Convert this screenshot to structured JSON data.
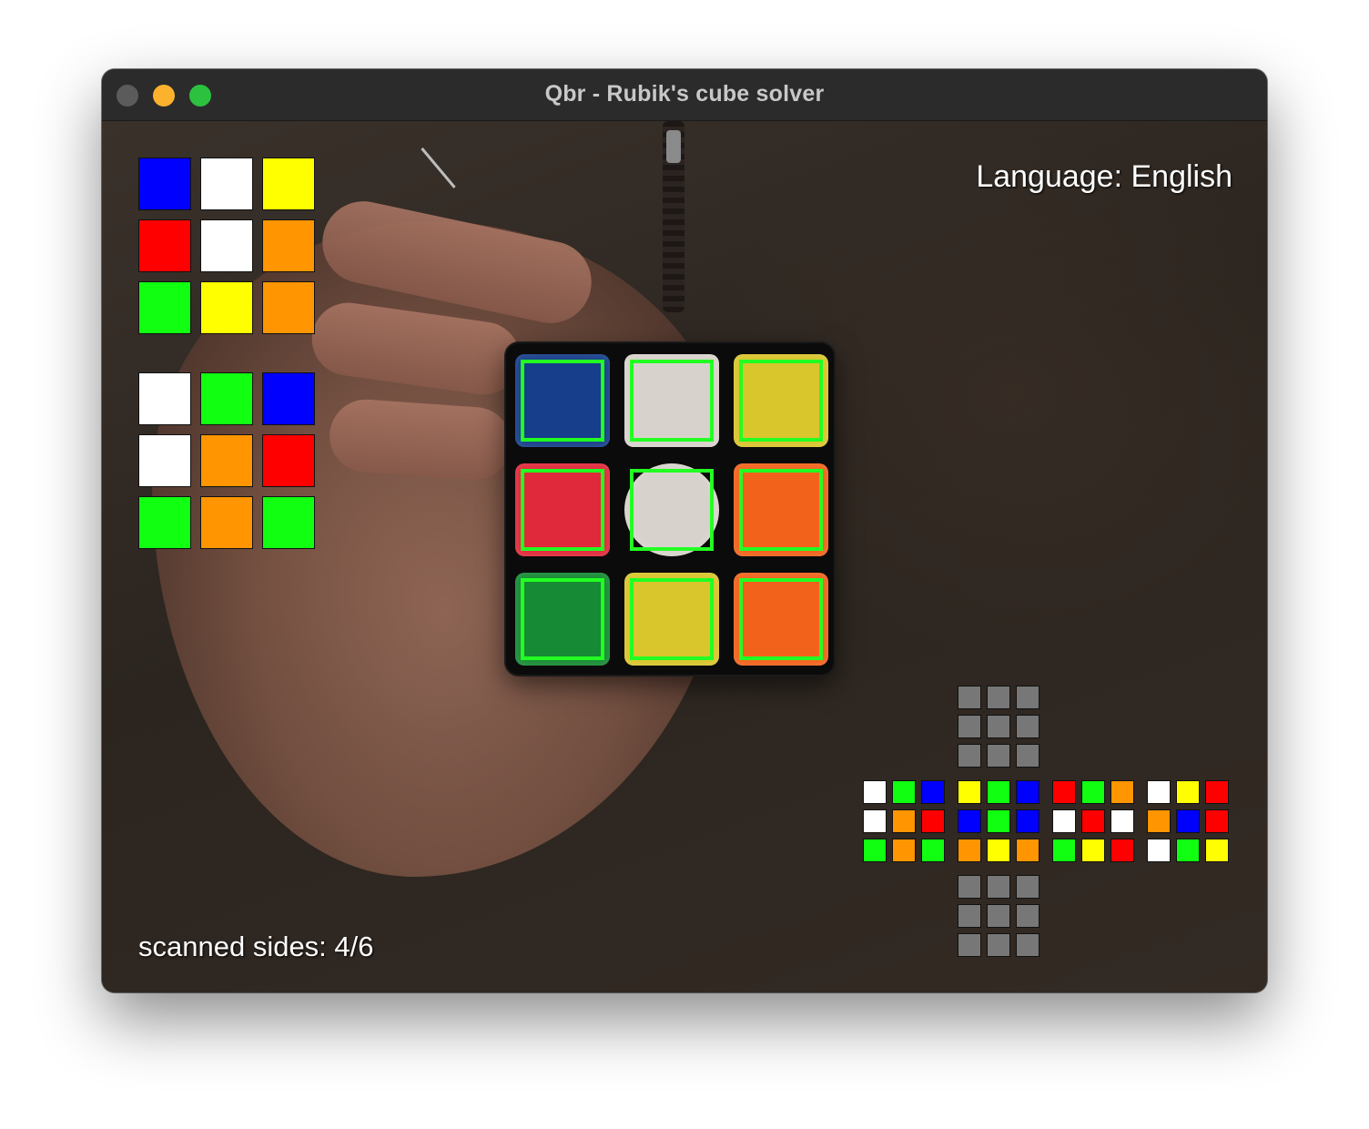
{
  "window": {
    "title": "Qbr - Rubik's cube solver"
  },
  "overlay": {
    "language_label": "Language: English",
    "scanned_label": "scanned sides: 4/6"
  },
  "colors": {
    "blue": "#0000ff",
    "white": "#ffffff",
    "yellow": "#ffff00",
    "red": "#ff0000",
    "orange": "#ff9500",
    "green": "#11ff11",
    "empty": "#777777"
  },
  "preview_current": [
    "blue",
    "white",
    "yellow",
    "red",
    "white",
    "orange",
    "green",
    "yellow",
    "orange"
  ],
  "preview_snapshot": [
    "white",
    "green",
    "blue",
    "white",
    "orange",
    "red",
    "green",
    "orange",
    "green"
  ],
  "detected_face": [
    "blue",
    "white",
    "yellow",
    "red",
    "white",
    "orange",
    "green",
    "yellow",
    "orange"
  ],
  "net": {
    "up": [
      "empty",
      "empty",
      "empty",
      "empty",
      "empty",
      "empty",
      "empty",
      "empty",
      "empty"
    ],
    "left": [
      "white",
      "green",
      "blue",
      "white",
      "orange",
      "red",
      "green",
      "orange",
      "green"
    ],
    "front": [
      "yellow",
      "green",
      "blue",
      "blue",
      "green",
      "blue",
      "orange",
      "yellow",
      "orange"
    ],
    "right": [
      "red",
      "green",
      "orange",
      "white",
      "red",
      "white",
      "green",
      "yellow",
      "red"
    ],
    "back": [
      "white",
      "yellow",
      "red",
      "orange",
      "blue",
      "red",
      "white",
      "green",
      "yellow"
    ],
    "down": [
      "empty",
      "empty",
      "empty",
      "empty",
      "empty",
      "empty",
      "empty",
      "empty",
      "empty"
    ]
  }
}
